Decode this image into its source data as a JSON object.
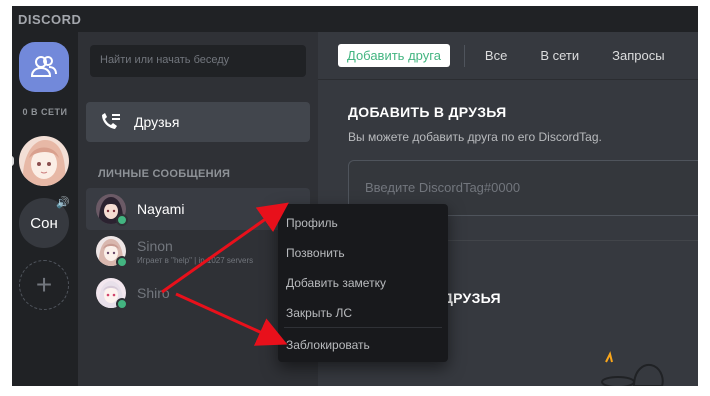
{
  "app": {
    "brand": "DISCORD"
  },
  "guilds": {
    "online_label": "0 В СЕТИ",
    "son_label": "Сон",
    "add_label": "+"
  },
  "sidebar": {
    "search_placeholder": "Найти или начать беседу",
    "friends_label": "Друзья",
    "dm_header": "ЛИЧНЫЕ СООБЩЕНИЯ",
    "dms": [
      {
        "name": "Nayami",
        "subtitle": "",
        "status": "online"
      },
      {
        "name": "Sinon",
        "subtitle": "Играет в \"help\" | in 1027 servers",
        "status": "online"
      },
      {
        "name": "Shiro",
        "subtitle": "",
        "status": "online"
      }
    ],
    "close_symbol": "×"
  },
  "tabs": {
    "add_friend": "Добавить друга",
    "all": "Все",
    "online": "В сети",
    "requests": "Запросы"
  },
  "add_friends": {
    "title": "ДОБАВИТЬ В ДРУЗЬЯ",
    "description": "Вы можете добавить друга по его DiscordTag.",
    "input_placeholder": "Введите DiscordTag#0000"
  },
  "other_friends": {
    "title": "Е ДРУЗЬЯ"
  },
  "context_menu": {
    "items": [
      "Профиль",
      "Позвонить",
      "Добавить заметку",
      "Закрыть ЛС"
    ],
    "block": "Заблокировать"
  },
  "colors": {
    "blurple": "#7289da",
    "online_green": "#43b581",
    "arrow_red": "#e8101b"
  }
}
